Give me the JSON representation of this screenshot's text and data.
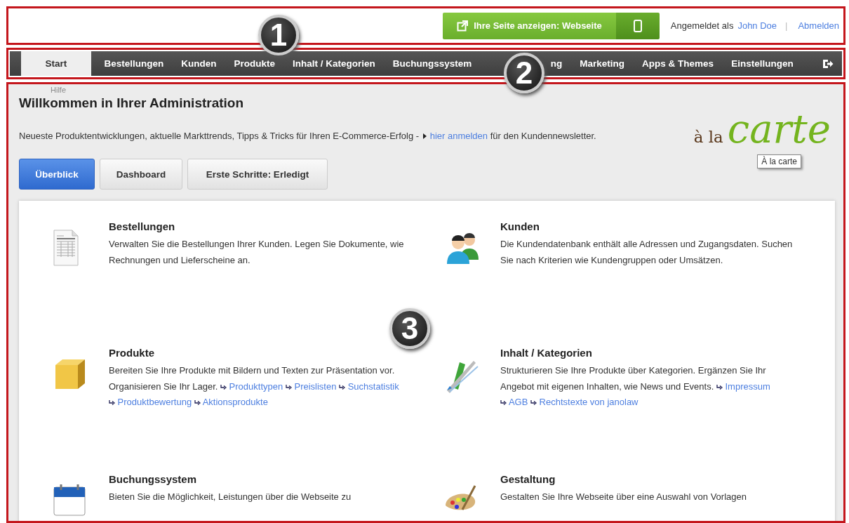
{
  "header": {
    "view_button": "Ihre Seite anzeigen: Webseite",
    "logged_in_label": "Angemeldet als",
    "user": "John Doe",
    "separator": "|",
    "logout": "Abmelden"
  },
  "nav": [
    {
      "label": "Start",
      "selected": true
    },
    {
      "label": "Bestellungen",
      "selected": false
    },
    {
      "label": "Kunden",
      "selected": false
    },
    {
      "label": "Produkte",
      "selected": false
    },
    {
      "label": "Inhalt / Kategorien",
      "selected": false
    },
    {
      "label": "Buchungssystem",
      "selected": false
    },
    {
      "label": "ng",
      "selected": false
    },
    {
      "label": "Marketing",
      "selected": false
    },
    {
      "label": "Apps & Themes",
      "selected": false
    },
    {
      "label": "Einstellungen",
      "selected": false
    }
  ],
  "main": {
    "help": "Hilfe",
    "title": "Willkommen in Ihrer Administration",
    "newsletter": {
      "before": "Neueste Produktentwicklungen, aktuelle Markttrends, Tipps & Tricks für Ihren E-Commerce-Erfolg -",
      "link": "hier anmelden",
      "after": "für den Kundennewsletter."
    },
    "logo": {
      "small": "à la",
      "large": "carte",
      "tooltip": "À la carte"
    },
    "tabs": [
      {
        "label": "Überblick",
        "selected": true
      },
      {
        "label": "Dashboard",
        "selected": false
      },
      {
        "label": "Erste Schritte: Erledigt",
        "selected": false
      }
    ],
    "items": [
      {
        "kind": "document",
        "title": "Bestellungen",
        "description": "Verwalten Sie die Bestellungen Ihrer Kunden. Legen Sie Dokumente, wie Rechnungen und Lieferscheine an."
      },
      {
        "kind": "people",
        "title": "Kunden",
        "description": "Die Kundendatenbank enthält alle Adressen und Zugangsdaten. Suchen Sie nach Kriterien wie Kundengruppen oder Umsätzen."
      },
      {
        "kind": "box",
        "title": "Produkte",
        "description": "Bereiten Sie Ihre Produkte mit Bildern und Texten zur Präsentation vor. Organisieren Sie Ihr Lager.",
        "links": [
          "Produkttypen",
          "Preislisten",
          "Suchstatistik",
          "Produktbewertung",
          "Aktionsprodukte"
        ]
      },
      {
        "kind": "pens",
        "title": "Inhalt / Kategorien",
        "description": "Strukturieren Sie Ihre Produkte über Kategorien. Ergänzen Sie Ihr Angebot mit eigenen Inhalten, wie News und Events.",
        "links": [
          "Impressum",
          "AGB",
          "Rechtstexte von janolaw"
        ]
      },
      {
        "kind": "calendar",
        "title": "Buchungssystem",
        "description": "Bieten Sie die Möglichkeit, Leistungen über die Webseite zu"
      },
      {
        "kind": "palette",
        "title": "Gestaltung",
        "description": "Gestalten Sie Ihre Webseite über eine Auswahl von Vorlagen"
      }
    ]
  },
  "callouts": [
    {
      "number": "1"
    },
    {
      "number": "2"
    },
    {
      "number": "3"
    }
  ]
}
